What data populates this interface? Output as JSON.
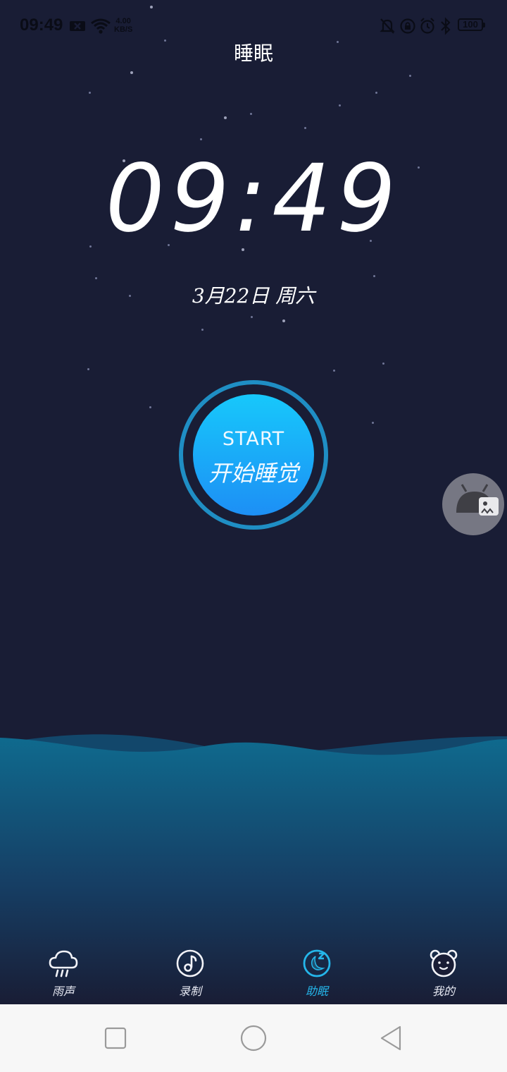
{
  "status_bar": {
    "time": "09:49",
    "net_speed_value": "4.00",
    "net_speed_unit": "KB/S",
    "battery": "100",
    "icons": [
      "sim-x-icon",
      "wifi-icon",
      "mute-bell-icon",
      "lock-rotation-icon",
      "alarm-icon",
      "bluetooth-icon",
      "battery-icon"
    ]
  },
  "header": {
    "title": "睡眠"
  },
  "clock": {
    "time": "09:49",
    "date": "3月22日 周六"
  },
  "start_button": {
    "label_en": "START",
    "label_cn": "开始睡觉"
  },
  "tabs": [
    {
      "label": "雨声",
      "icon": "rain-cloud-icon",
      "active": false
    },
    {
      "label": "录制",
      "icon": "music-note-icon",
      "active": false
    },
    {
      "label": "助眠",
      "icon": "moon-sleep-icon",
      "active": true
    },
    {
      "label": "我的",
      "icon": "bear-face-icon",
      "active": false
    }
  ],
  "colors": {
    "background": "#191d35",
    "accent": "#25b6ea",
    "button_top": "#17c8fb",
    "button_bottom": "#1d8ff5",
    "wave": "#0f6a8e"
  },
  "system_nav": [
    "recents-square-icon",
    "home-circle-icon",
    "back-triangle-icon"
  ]
}
